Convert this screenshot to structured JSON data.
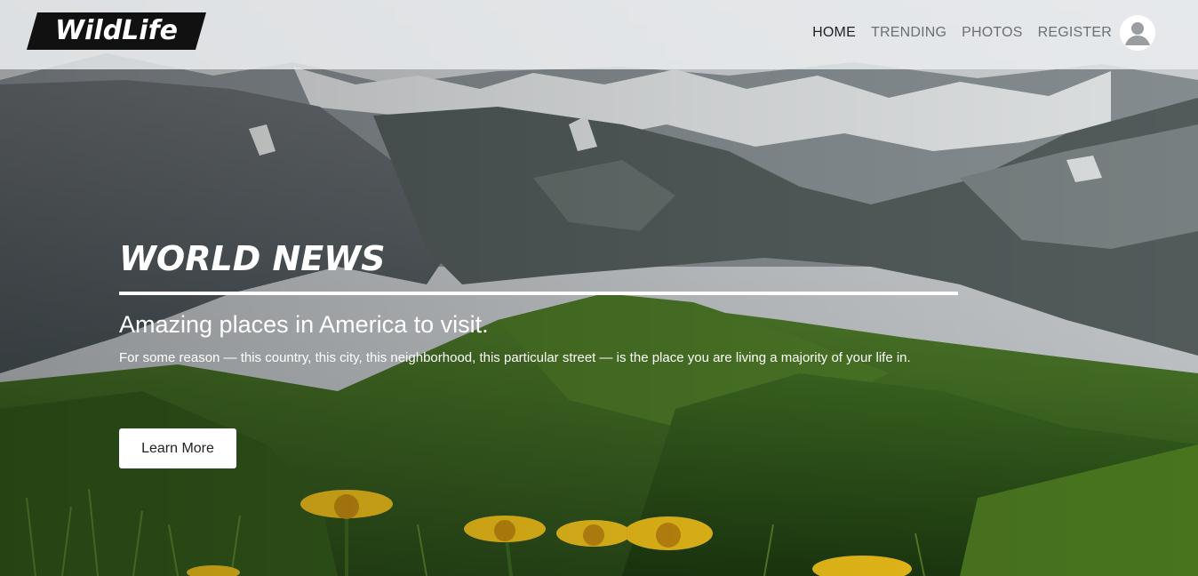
{
  "header": {
    "logo_text": "WildLife",
    "nav": [
      {
        "label": "HOME",
        "active": true
      },
      {
        "label": "TRENDING",
        "active": false
      },
      {
        "label": "PHOTOS",
        "active": false
      },
      {
        "label": "REGISTER",
        "active": false
      }
    ],
    "avatar_icon": "user-avatar-icon"
  },
  "hero": {
    "headline": "WORLD NEWS",
    "subheadline": "Amazing places in America to visit.",
    "body": "For some reason — this country, this city, this neighborhood, this particular street — is the place you are living a majority of your life in.",
    "cta_label": "Learn More"
  },
  "colors": {
    "navbar_bg": "#eceef0",
    "nav_text": "#6c6f73",
    "nav_active": "#1f2225",
    "logo_bg": "#111111",
    "hero_text": "#ffffff",
    "button_bg": "#ffffff"
  }
}
